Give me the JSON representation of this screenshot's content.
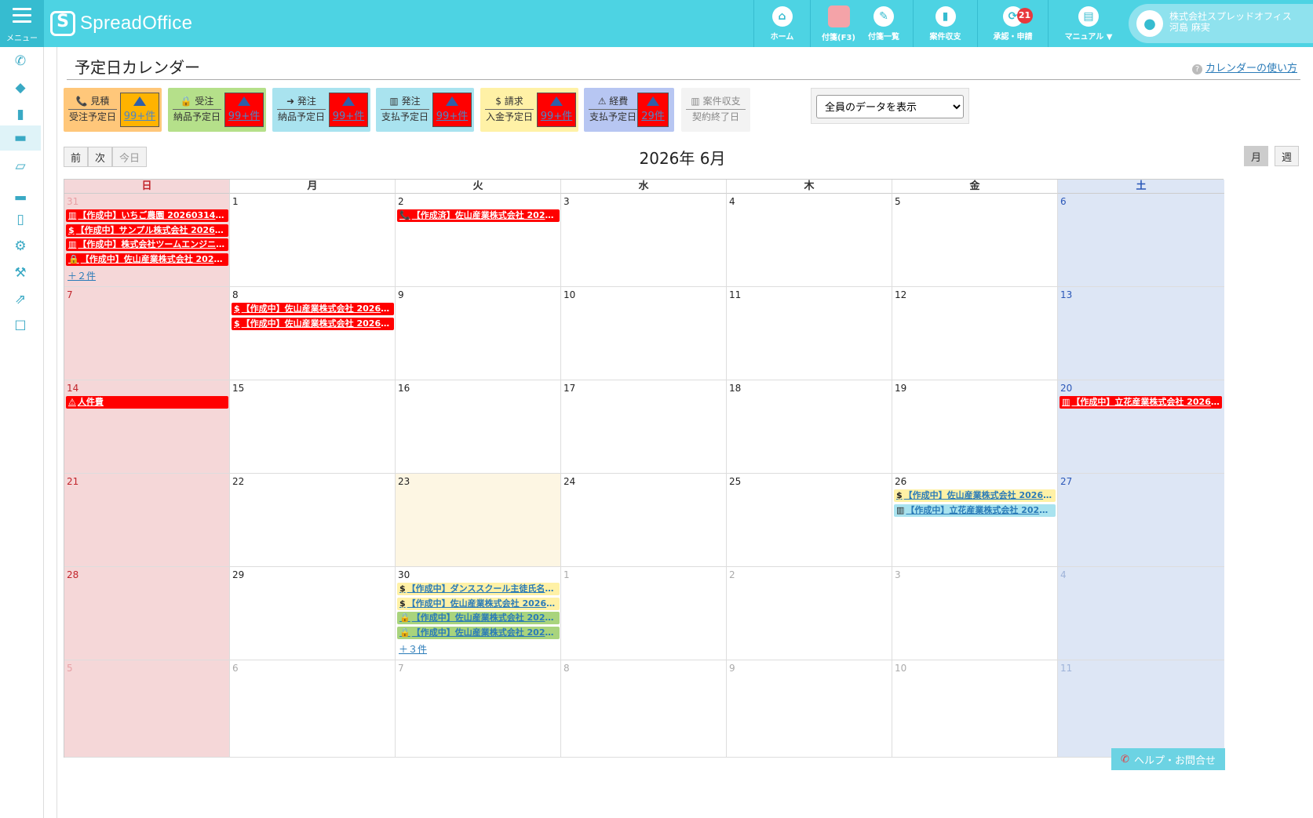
{
  "topbar": {
    "menu_label": "メニュー",
    "logo_text": "SpreadOffice",
    "nav": [
      {
        "label": "ホーム",
        "icon": "home-icon"
      },
      {
        "label": "付箋(F3)",
        "icon": "sticky-note-icon"
      },
      {
        "label": "付箋一覧",
        "icon": "pin-icon"
      },
      {
        "label": "案件収支",
        "icon": "chart-icon"
      },
      {
        "label": "承認・申請",
        "icon": "refresh-icon",
        "badge": "21"
      },
      {
        "label": "マニュアル ▼",
        "icon": "book-icon"
      }
    ],
    "user": {
      "company": "株式会社スプレッドオフィス",
      "name": "河島 麻実"
    }
  },
  "sidebar": {
    "items": [
      "phone-icon",
      "tag-icon",
      "bar-chart-icon",
      "card-icon",
      "folder-icon",
      "signal-icon",
      "file-icon",
      "gear-icon",
      "wrench-icon",
      "external-link-icon",
      "checkbox-icon"
    ]
  },
  "page": {
    "title": "予定日カレンダー",
    "help_link": "カレンダーの使い方"
  },
  "summary": [
    {
      "icon": "📞",
      "label": "見積",
      "sub": "受注予定日",
      "count": "99+件",
      "bg": "#ffc77a",
      "cnt_color": "orange"
    },
    {
      "icon": "🔒",
      "label": "受注",
      "sub": "納品予定日",
      "count": "99+件",
      "bg": "#b5e08a",
      "cnt_color": "red"
    },
    {
      "icon": "➜",
      "label": "発注",
      "sub": "納品予定日",
      "count": "99+件",
      "bg": "#a9e3ef",
      "cnt_color": "red"
    },
    {
      "icon": "▥",
      "label": "発注",
      "sub": "支払予定日",
      "count": "99+件",
      "bg": "#a9e3ef",
      "cnt_color": "red"
    },
    {
      "icon": "$",
      "label": "請求",
      "sub": "入金予定日",
      "count": "99+件",
      "bg": "#fff1a6",
      "cnt_color": "red"
    },
    {
      "icon": "⚠",
      "label": "経費",
      "sub": "支払予定日",
      "count": "29件",
      "bg": "#b7c6f2",
      "cnt_color": "red"
    },
    {
      "icon": "▥",
      "label": "案件収支",
      "sub": "契約終了日",
      "count": "",
      "bg": "#f3f3f3",
      "cnt_color": "none"
    }
  ],
  "filter": {
    "selected": "全員のデータを表示"
  },
  "nav_buttons": {
    "prev": "前",
    "next": "次",
    "today": "今日"
  },
  "calendar_title": "2026年 6月",
  "view_buttons": {
    "month": "月",
    "week": "週"
  },
  "weekdays": [
    "日",
    "月",
    "火",
    "水",
    "木",
    "金",
    "土"
  ],
  "weeks": [
    [
      "31",
      "1",
      "2",
      "3",
      "4",
      "5",
      "6"
    ],
    [
      "7",
      "8",
      "9",
      "10",
      "11",
      "12",
      "13"
    ],
    [
      "14",
      "15",
      "16",
      "17",
      "18",
      "19",
      "20"
    ],
    [
      "21",
      "22",
      "23",
      "24",
      "25",
      "26",
      "27"
    ],
    [
      "28",
      "29",
      "30",
      "1",
      "2",
      "3",
      "4"
    ],
    [
      "5",
      "6",
      "7",
      "8",
      "9",
      "10",
      "11"
    ]
  ],
  "events": {
    "0-0": [
      {
        "icon": "▥",
        "text": "【作成中】いちご農園 2026031400…",
        "color": "red"
      },
      {
        "icon": "$",
        "text": "【作成中】サンプル株式会社 202602…",
        "color": "red"
      },
      {
        "icon": "▥",
        "text": "【作成中】株式会社ツームエンジニア…",
        "color": "red"
      },
      {
        "icon": "🔒",
        "text": "【作成中】佐山産業株式会社 202604…",
        "color": "red"
      }
    ],
    "0-2": [
      {
        "icon": "📞",
        "text": "【作成済】佐山産業株式会社 20260…",
        "color": "red"
      }
    ],
    "1-1": [
      {
        "icon": "$",
        "text": "【作成中】佐山産業株式会社 20260…",
        "color": "red"
      },
      {
        "icon": "$",
        "text": "【作成中】佐山産業株式会社 20260…",
        "color": "red"
      }
    ],
    "2-0": [
      {
        "icon": "⚠",
        "text": "人件費",
        "color": "red"
      }
    ],
    "2-6": [
      {
        "icon": "▥",
        "text": "【作成中】立花産業株式会社 202605…",
        "color": "red"
      }
    ],
    "3-5": [
      {
        "icon": "$",
        "text": "【作成中】佐山産業株式会社 20260…",
        "color": "yellow"
      },
      {
        "icon": "▥",
        "text": "【作成中】立花産業株式会社 20260…",
        "color": "blue"
      }
    ],
    "4-2": [
      {
        "icon": "$",
        "text": "【作成中】ダンススクール主徒氏名O…",
        "color": "yellow"
      },
      {
        "icon": "$",
        "text": "【作成中】佐山産業株式会社 20260…",
        "color": "yellow"
      },
      {
        "icon": "🔒",
        "text": "【作成中】佐山産業株式会社 20260…",
        "color": "green"
      },
      {
        "icon": "🔒",
        "text": "【作成中】佐山産業株式会社 20260…",
        "color": "green"
      }
    ]
  },
  "more": {
    "0-0": "＋２件",
    "4-2": "＋３件"
  },
  "help_button": "ヘルプ・お問合せ"
}
